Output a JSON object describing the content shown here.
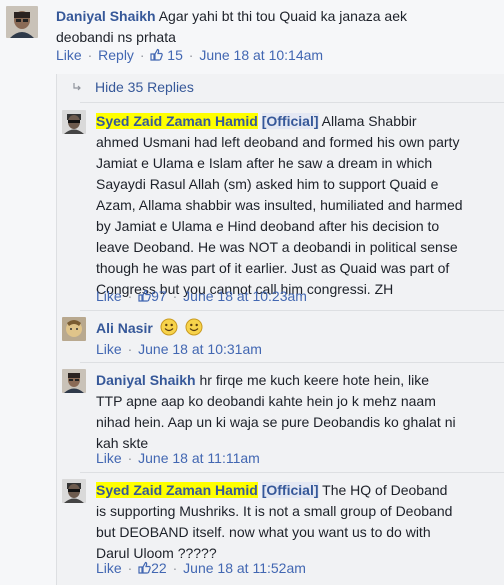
{
  "top_comment": {
    "author": "Daniyal Shaikh",
    "text_line1": "Agar yahi bt thi tou Quaid ka janaza aek",
    "text_line2": "deobandi ns prhata",
    "like_label": "Like",
    "reply_label": "Reply",
    "likes": "15",
    "time": "June 18 at 10:14am"
  },
  "hide_replies_label": "Hide 35 Replies",
  "replies": [
    {
      "author": "Syed Zaid Zaman Hamid",
      "tag": "[Official]",
      "lines": [
        "Allama Shabbir",
        "ahmed Usmani had left deoband and formed his own party",
        "Jamiat e Ulama e Islam after he saw a dream in which",
        "Sayaydi Rasul Allah (sm) asked him to support Quaid e",
        "Azam, Allama shabbir was insulted, humiliated and harmed",
        "by Jamiat e Ulama e Hind deoband after his decision to",
        "leave Deoband. He was NOT a deobandi in political sense",
        "though he was part of it earlier. Just as Quaid was part of",
        "Congress but you cannot call him congressi. ZH"
      ],
      "like_label": "Like",
      "likes": "97",
      "time": "June 18 at 10:23am"
    },
    {
      "author": "Ali Nasir",
      "emoticons": [
        "smiley",
        "smiley"
      ],
      "like_label": "Like",
      "time": "June 18 at 10:31am"
    },
    {
      "author": "Daniyal Shaikh",
      "lines": [
        "hr firqe me kuch keere hote hein, like",
        "TTP apne aap ko deobandi kahte hein jo k mehz naam",
        "nihad hein. Aap un ki waja se pure Deobandis ko ghalat ni",
        "kah skte"
      ],
      "like_label": "Like",
      "time": "June 18 at 11:11am"
    },
    {
      "author": "Syed Zaid Zaman Hamid",
      "tag": "[Official]",
      "lines": [
        "The HQ of Deoband",
        "is supporting Mushriks. It is not a small group of Deoband",
        "but DEOBAND itself. now what you want us to do with",
        "Darul Uloom ?????"
      ],
      "like_label": "Like",
      "likes": "22",
      "time": "June 18 at 11:52am"
    }
  ],
  "colors": {
    "link": "#365899",
    "highlight": "#ffff00",
    "meta": "#90949c"
  }
}
